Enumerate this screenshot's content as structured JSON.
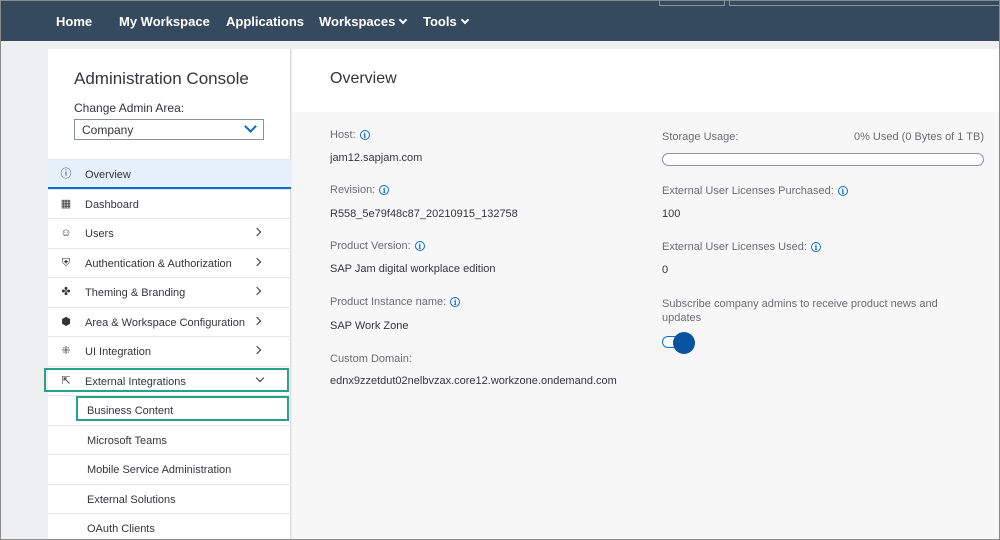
{
  "nav": {
    "items": [
      {
        "label": "Home",
        "dropdown": false
      },
      {
        "label": "My Workspace",
        "dropdown": false
      },
      {
        "label": "Applications",
        "dropdown": false
      },
      {
        "label": "Workspaces",
        "dropdown": true
      },
      {
        "label": "Tools",
        "dropdown": true
      }
    ]
  },
  "sidebar": {
    "title": "Administration Console",
    "area_label": "Change Admin Area:",
    "area_value": "Company",
    "items": [
      {
        "label": "Overview",
        "icon": "info-circle-icon",
        "glyph": "ⓘ",
        "chevron": "none",
        "selected": true
      },
      {
        "label": "Dashboard",
        "icon": "dashboard-icon",
        "glyph": "▦",
        "chevron": "none"
      },
      {
        "label": "Users",
        "icon": "user-icon",
        "glyph": "☺",
        "chevron": "right"
      },
      {
        "label": "Authentication & Authorization",
        "icon": "shield-lock-icon",
        "glyph": "⛨",
        "chevron": "right"
      },
      {
        "label": "Theming & Branding",
        "icon": "palette-icon",
        "glyph": "✤",
        "chevron": "right"
      },
      {
        "label": "Area & Workspace Configuration",
        "icon": "cube-icon",
        "glyph": "⬢",
        "chevron": "right"
      },
      {
        "label": "UI Integration",
        "icon": "integration-icon",
        "glyph": "⁜",
        "chevron": "right"
      },
      {
        "label": "External Integrations",
        "icon": "external-link-icon",
        "glyph": "⇱",
        "chevron": "down",
        "highlighted": true
      },
      {
        "label": "Business Content",
        "sub": true,
        "highlighted": true
      },
      {
        "label": "Microsoft Teams",
        "sub": true
      },
      {
        "label": "Mobile Service Administration",
        "sub": true
      },
      {
        "label": "External Solutions",
        "sub": true
      },
      {
        "label": "OAuth Clients",
        "sub": true
      }
    ]
  },
  "main": {
    "title": "Overview",
    "left_fields": [
      {
        "label": "Host:",
        "value": "jam12.sapjam.com",
        "info": true
      },
      {
        "label": "Revision:",
        "value": "R558_5e79f48c87_20210915_132758",
        "info": true
      },
      {
        "label": "Product Version:",
        "value": "SAP Jam digital workplace edition",
        "info": true
      },
      {
        "label": "Product Instance name:",
        "value": "SAP Work Zone",
        "info": true
      },
      {
        "label": "Custom Domain:",
        "value": "ednx9zzetdut02nelbvzax.core12.workzone.ondemand.com",
        "info": false
      }
    ],
    "storage": {
      "label": "Storage Usage:",
      "value": "0% Used (0 Bytes of 1 TB)",
      "percent": 0
    },
    "licenses_purchased": {
      "label": "External User Licenses Purchased:",
      "value": "100"
    },
    "licenses_used": {
      "label": "External User Licenses Used:",
      "value": "0"
    },
    "subscribe": {
      "label": "Subscribe company admins to receive product news and updates",
      "enabled": true
    }
  },
  "colors": {
    "nav_bg": "#354a5f",
    "accent": "#0a6ed1",
    "toggle_on": "#0854a0",
    "highlight": "#2aa08a"
  }
}
